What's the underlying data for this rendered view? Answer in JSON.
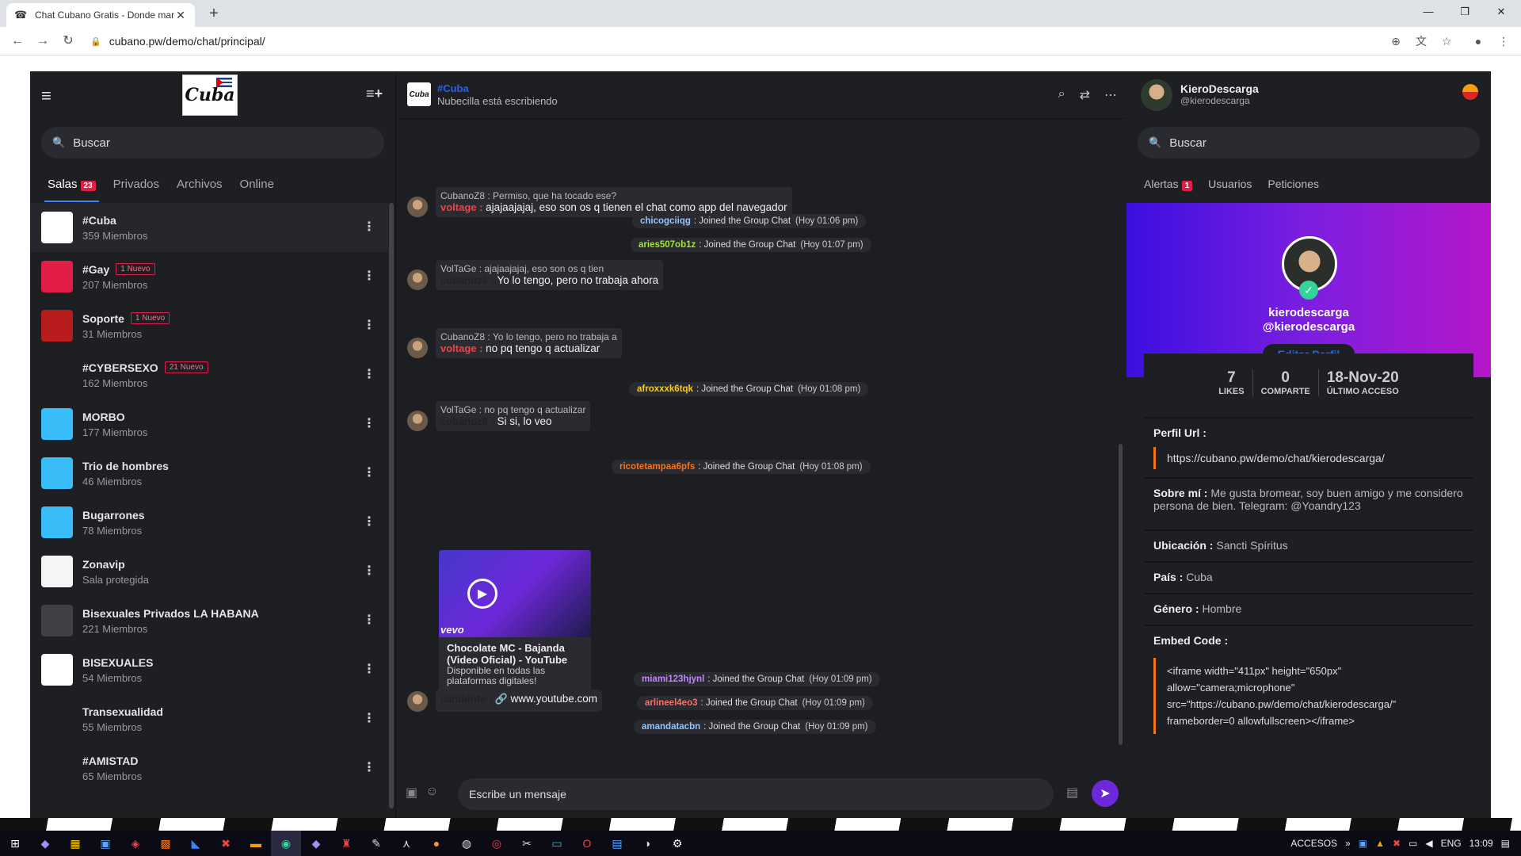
{
  "browser": {
    "tab_title": "Chat Cubano Gratis - Donde mar",
    "url": "cubano.pw/demo/chat/principal/"
  },
  "left": {
    "search_placeholder": "Buscar",
    "tabs": [
      {
        "label": "Salas",
        "badge": "23"
      },
      {
        "label": "Privados"
      },
      {
        "label": "Archivos"
      },
      {
        "label": "Online"
      }
    ],
    "rooms": [
      {
        "name": "#Cuba",
        "members": "359 Miembros",
        "nuevo": "",
        "color": "#ffffff"
      },
      {
        "name": "#Gay",
        "members": "207 Miembros",
        "nuevo": "1 Nuevo",
        "color": "#e11d48"
      },
      {
        "name": "Soporte",
        "members": "31 Miembros",
        "nuevo": "1 Nuevo",
        "color": "#b91c1c"
      },
      {
        "name": "#CYBERSEXO",
        "members": "162 Miembros",
        "nuevo": "21 Nuevo",
        "color": "#1d1e22"
      },
      {
        "name": "MORBO",
        "members": "177 Miembros",
        "nuevo": "",
        "color": "#38bdf8"
      },
      {
        "name": "Trio de hombres",
        "members": "46 Miembros",
        "nuevo": "",
        "color": "#38bdf8"
      },
      {
        "name": "Bugarrones",
        "members": "78 Miembros",
        "nuevo": "",
        "color": "#38bdf8"
      },
      {
        "name": "Zonavip",
        "members": "Sala protegida",
        "nuevo": "",
        "color": "#f5f5f5"
      },
      {
        "name": "Bisexuales Privados LA HABANA",
        "members": "221 Miembros",
        "nuevo": "",
        "color": "#3f3f46"
      },
      {
        "name": "BISEXUALES",
        "members": "54 Miembros",
        "nuevo": "",
        "color": "#ffffff"
      },
      {
        "name": "Transexualidad",
        "members": "55 Miembros",
        "nuevo": "",
        "color": "#1d1e22"
      },
      {
        "name": "#AMISTAD",
        "members": "65 Miembros",
        "nuevo": "",
        "color": "#1d1e22"
      }
    ]
  },
  "chat": {
    "room_title": "#Cuba",
    "typing_status": "Nubecilla está escribiendo",
    "messages": [
      {
        "quote": "CubanoZ8 : Permiso, que ha tocado ese?",
        "who": "voltage :",
        "text": "ajajaajajaj, eso son os q tienen el chat como app del navegador"
      },
      {
        "quote": "VolTaGe : ajajaajajaj, eso son os q tien",
        "who": "cubanoz8 :",
        "text": "Yo lo tengo, pero no trabaja ahora"
      },
      {
        "quote": "CubanoZ8 : Yo lo tengo, pero no trabaja a",
        "who": "voltage :",
        "text": "no pq tengo q actualizar"
      },
      {
        "quote": "VolTaGe : no pq tengo q actualizar",
        "who": "cubanoz8 :",
        "text": "Si si, lo veo"
      }
    ],
    "joins": [
      {
        "user": "chicogciiqg",
        "text": "Joined the Group Chat",
        "time": "(Hoy 01:06 pm)",
        "color": "#93c5fd"
      },
      {
        "user": "aries507ob1z",
        "text": "Joined the Group Chat",
        "time": "(Hoy 01:07 pm)",
        "color": "#a3e635"
      },
      {
        "user": "afroxxxk6tqk",
        "text": "Joined the Group Chat",
        "time": "(Hoy 01:08 pm)",
        "color": "#facc15"
      },
      {
        "user": "ricotetampaa6pfs",
        "text": "Joined the Group Chat",
        "time": "(Hoy 01:08 pm)",
        "color": "#f97316"
      },
      {
        "user": "miami123hjynl",
        "text": "Joined the Group Chat",
        "time": "(Hoy 01:09 pm)",
        "color": "#c084fc"
      },
      {
        "user": "arlineel4eo3",
        "text": "Joined the Group Chat",
        "time": "(Hoy 01:09 pm)",
        "color": "#f87171"
      },
      {
        "user": "amandatacbn",
        "text": "Joined the Group Chat",
        "time": "(Hoy 01:09 pm)",
        "color": "#93c5fd"
      }
    ],
    "video": {
      "title": "Chocolate MC - Bajanda (Video Oficial) - YouTube",
      "desc": "Disponible en todas las plataformas digitales!",
      "brand": "vevo"
    },
    "link_msg": {
      "who": "candente :",
      "text": "www.youtube.com"
    },
    "composer_placeholder": "Escribe un mensaje"
  },
  "right": {
    "user_name": "KieroDescarga",
    "user_handle": "@kierodescarga",
    "search_placeholder": "Buscar",
    "tabs": [
      {
        "label": "Alertas",
        "badge": "1"
      },
      {
        "label": "Usuarios"
      },
      {
        "label": "Peticiones"
      }
    ],
    "profile": {
      "name": "kierodescarga",
      "handle": "@kierodescarga",
      "edit_label": "Editar Perfil",
      "stats": [
        {
          "value": "7",
          "label": "LIKES"
        },
        {
          "value": "0",
          "label": "COMPARTE"
        },
        {
          "value": "18-Nov-20",
          "label": "ÚLTIMO ACCESO"
        }
      ],
      "url_label": "Perfil Url :",
      "url": "https://cubano.pw/demo/chat/kierodescarga/",
      "about_label": "Sobre mí :",
      "about": "Me gusta bromear, soy buen amigo y me considero persona de bien. Telegram: @Yoandry123",
      "location_label": "Ubicación :",
      "location": "Sancti Spíritus",
      "country_label": "País :",
      "country": "Cuba",
      "gender_label": "Género :",
      "gender": "Hombre",
      "embed_label": "Embed Code :",
      "embed": "<iframe width=\"411px\" height=\"650px\" allow=\"camera;microphone\" src=\"https://cubano.pw/demo/chat/kierodescarga/\" frameborder=0 allowfullscreen></iframe>"
    }
  },
  "taskbar": {
    "accesos": "ACCESOS",
    "lang": "ENG",
    "time": "13:09"
  }
}
